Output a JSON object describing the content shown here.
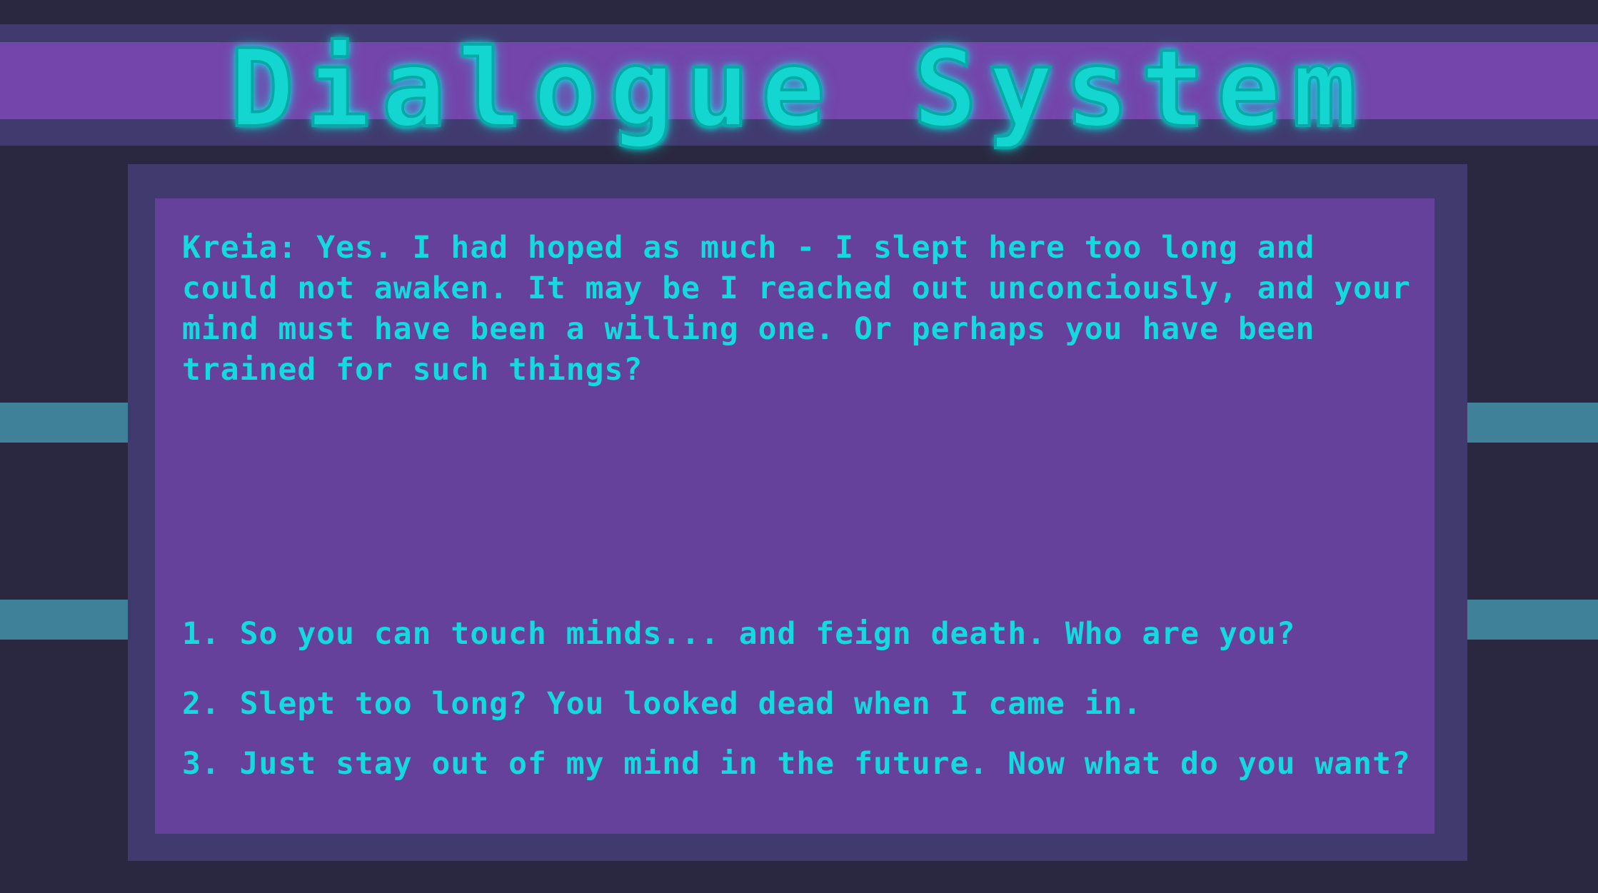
{
  "title": "Dialogue System",
  "dialogue": {
    "npc_line": "Kreia: Yes. I had hoped as much - I slept here too long and could not awaken. It may be I reached out unconciously, and your mind must have been a willing one. Or perhaps you have been trained for such things?",
    "choices": [
      {
        "label": "1. So you can touch minds... and feign death. Who are you?"
      },
      {
        "label": "2. Slept too long? You looked dead when I came in."
      },
      {
        "label": "3. Just stay out of my mind in the future. Now what do you want?"
      }
    ]
  },
  "colors": {
    "background": "#2a2840",
    "title_band_outer": "#413a6e",
    "title_band_inner": "#7445aa",
    "side_stripes": "#3e8199",
    "frame": "#403a6e",
    "panel": "#66419b",
    "text": "#14d9de",
    "title_glow": "#00fff6"
  }
}
